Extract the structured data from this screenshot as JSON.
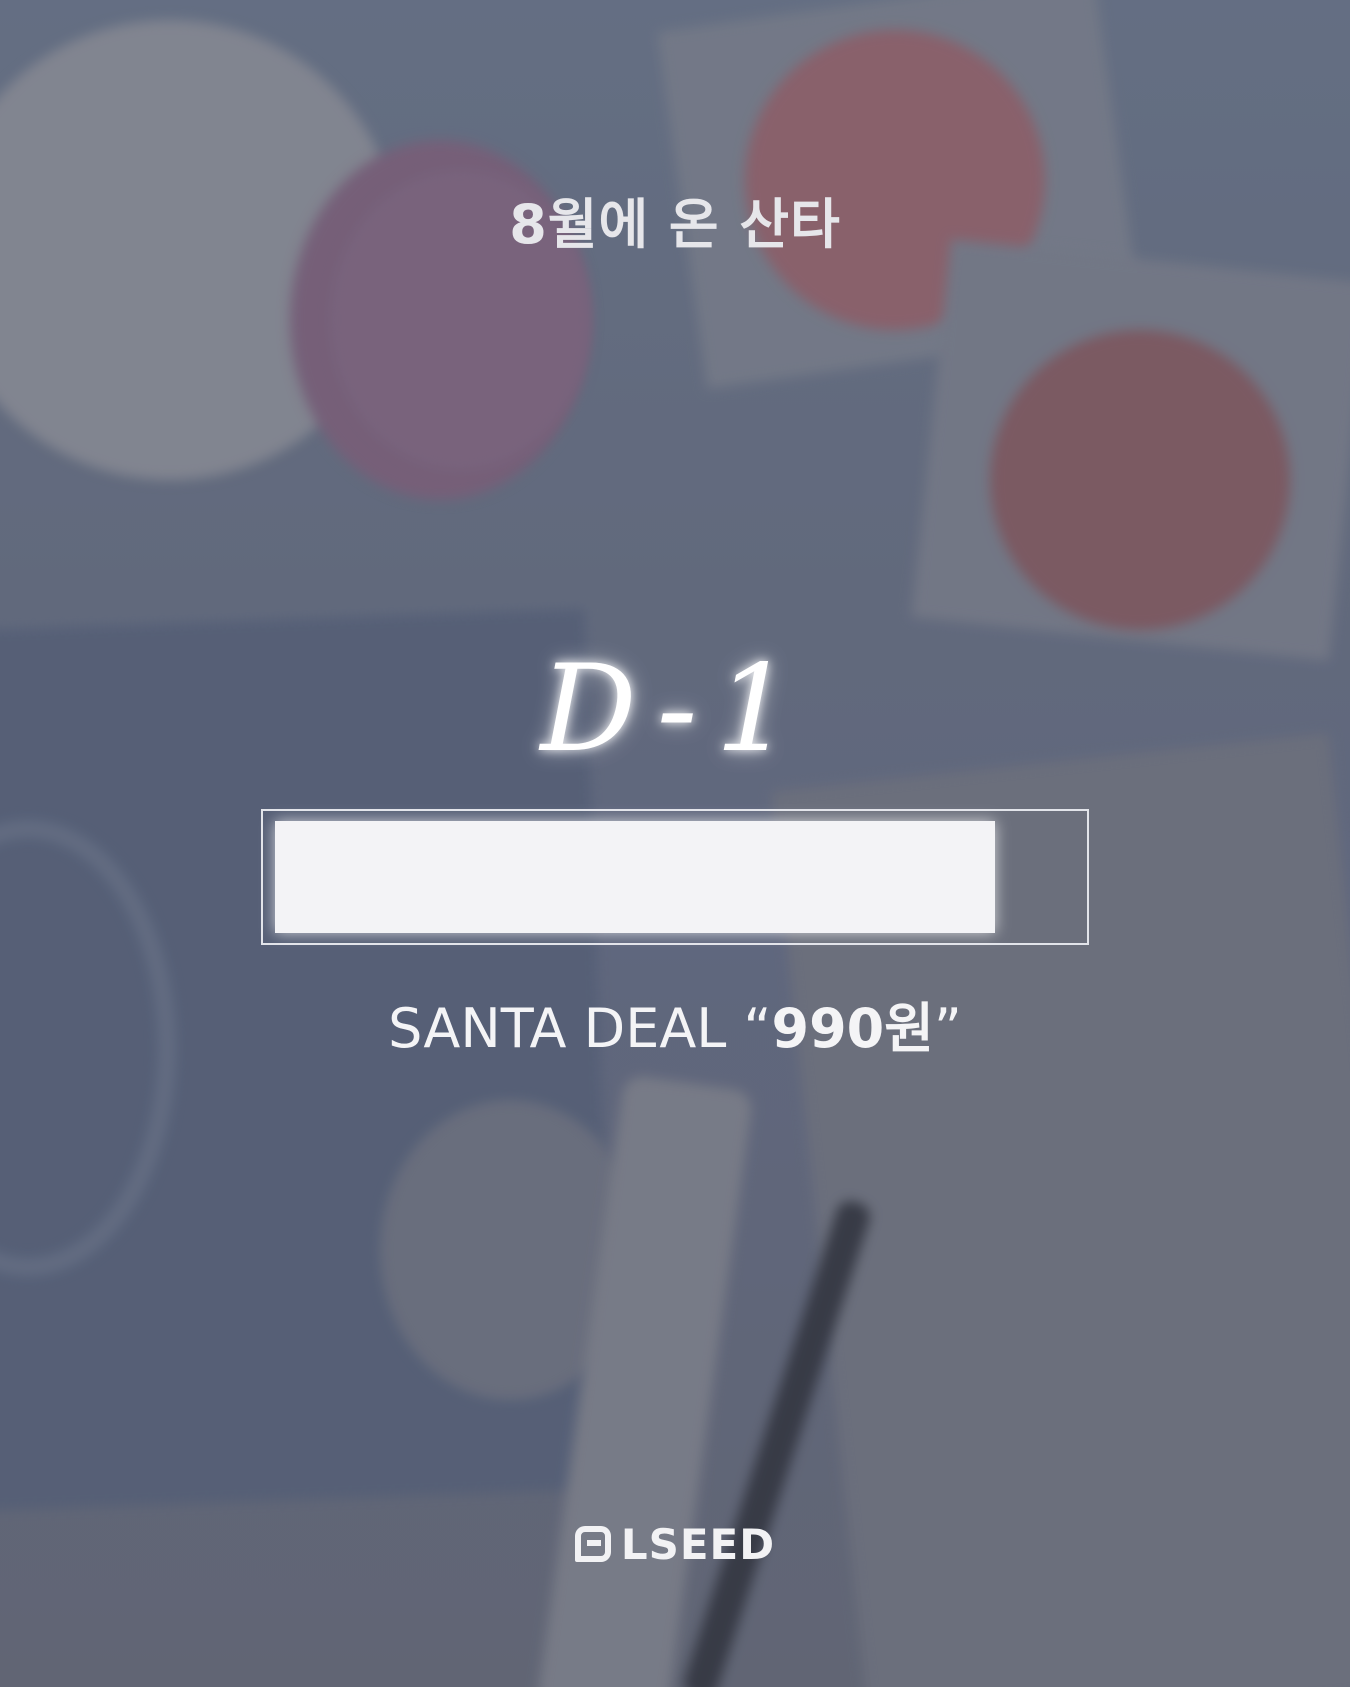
{
  "headline": "8월에 온 산타",
  "countdown": "D-1",
  "progress": {
    "fraction": 0.9
  },
  "deal": {
    "prefix": "SANTA DEAL “",
    "price": "990원",
    "suffix": "”"
  },
  "brand": {
    "name": "LSEED",
    "icon": "lseed-logo-icon"
  },
  "colors": {
    "text": "#f4f4f6",
    "progress_fill": "#f3f3f6",
    "accent_pink": "#a8676e"
  }
}
